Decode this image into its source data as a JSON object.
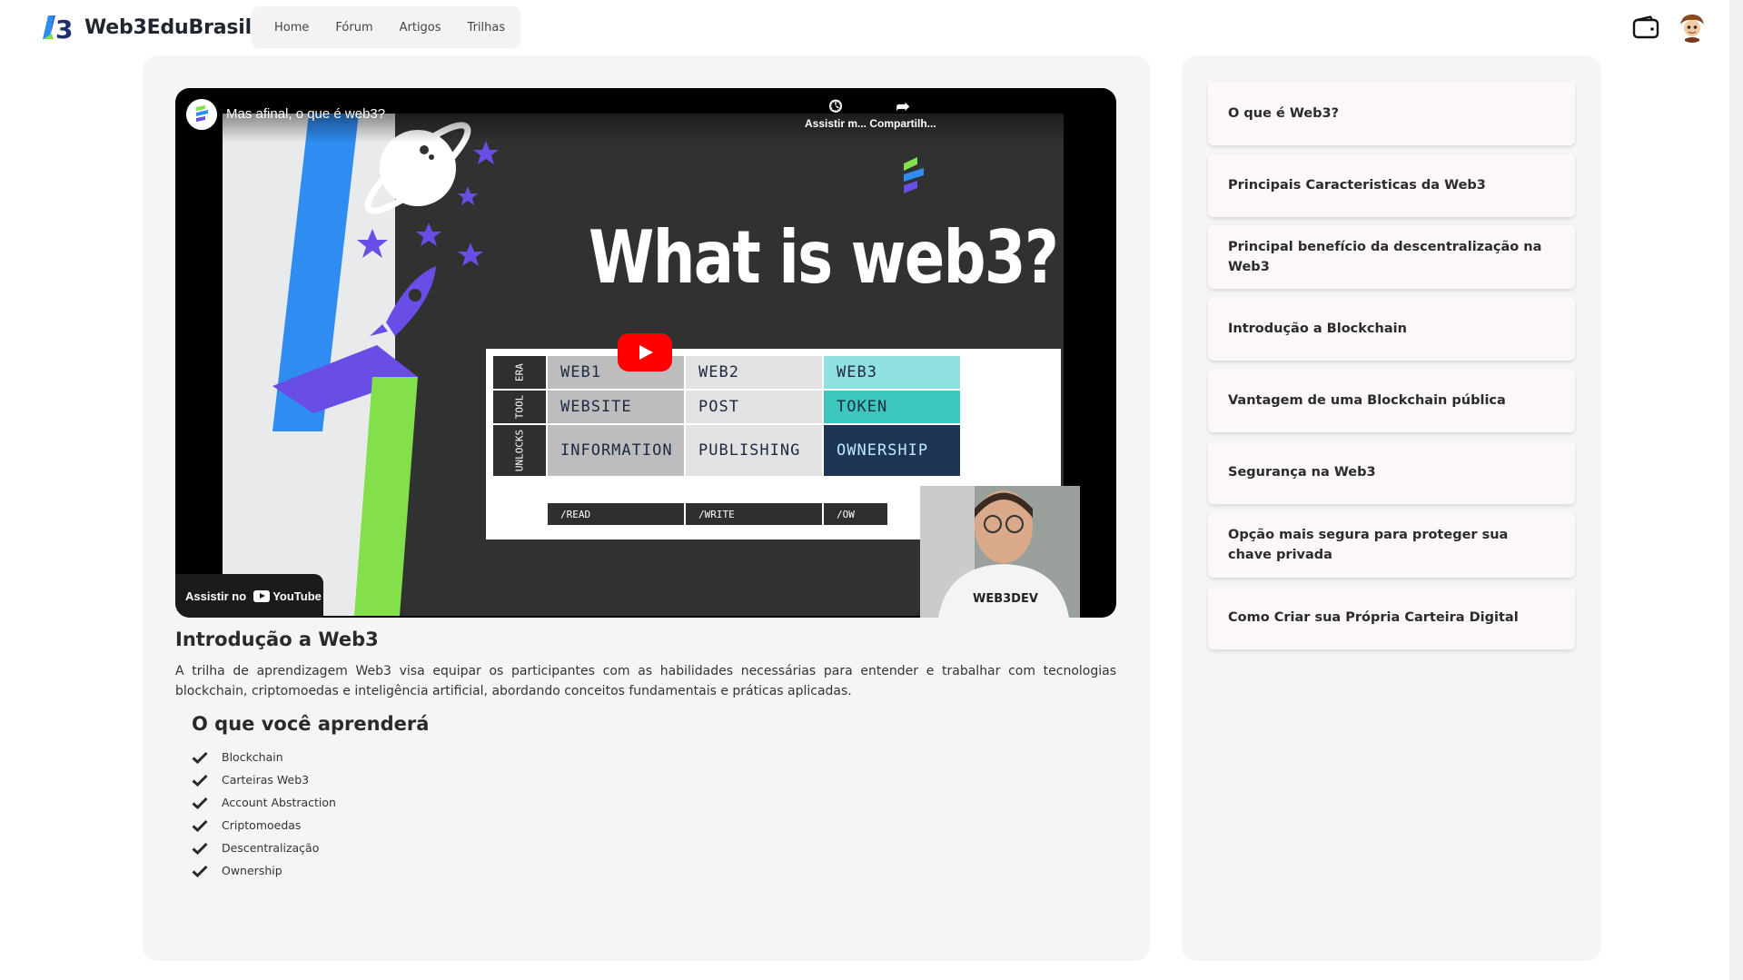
{
  "header": {
    "brand": "Web3EduBrasil",
    "nav": [
      "Home",
      "Fórum",
      "Artigos",
      "Trilhas"
    ]
  },
  "video": {
    "title": "Mas afinal, o que é web3?",
    "watch_later": "Assistir m...",
    "share": "Compartilh...",
    "watch_on": "Assistir no",
    "youtube": "YouTube",
    "slide_headline": "What is web3?",
    "table": {
      "rows": [
        "ERA",
        "TOOL",
        "UNLOCKS"
      ],
      "web1": [
        "WEB1",
        "WEBSITE",
        "INFORMATION"
      ],
      "web2": [
        "WEB2",
        "POST",
        "PUBLISHING"
      ],
      "web3": [
        "WEB3",
        "TOKEN",
        "OWNERSHIP"
      ],
      "footer": [
        "/READ",
        "/WRITE",
        "/OW"
      ]
    },
    "webcam_shirt": "WEB3DEV"
  },
  "course": {
    "title": "Introdução a Web3",
    "description": "A trilha de aprendizagem Web3 visa equipar os participantes com as habilidades necessárias para entender e trabalhar com tecnologias blockchain, criptomoedas e inteligência artificial, abordando conceitos fundamentais e práticas aplicadas.",
    "learn_title": "O que você aprenderá",
    "learn_items": [
      "Blockchain",
      "Carteiras Web3",
      "Account Abstraction",
      "Criptomoedas",
      "Descentralização",
      "Ownership"
    ]
  },
  "topics": [
    "O que é Web3?",
    "Principais Caracteristicas da Web3",
    "Principal benefício da descentralização na Web3",
    "Introdução a Blockchain",
    "Vantagem de uma Blockchain pública",
    "Segurança na Web3",
    "Opção mais segura para proteger sua chave privada",
    "Como Criar sua Própria Carteira Digital"
  ],
  "icons": {
    "check": "check-icon",
    "wallet": "wallet-icon",
    "avatar": "avatar-icon"
  },
  "colors": {
    "accent_blue": "#2f8cf0",
    "accent_purple": "#6a4de6",
    "accent_green": "#84e04a",
    "youtube_red": "#ff0000",
    "panel_bg": "#f6f5f5"
  }
}
